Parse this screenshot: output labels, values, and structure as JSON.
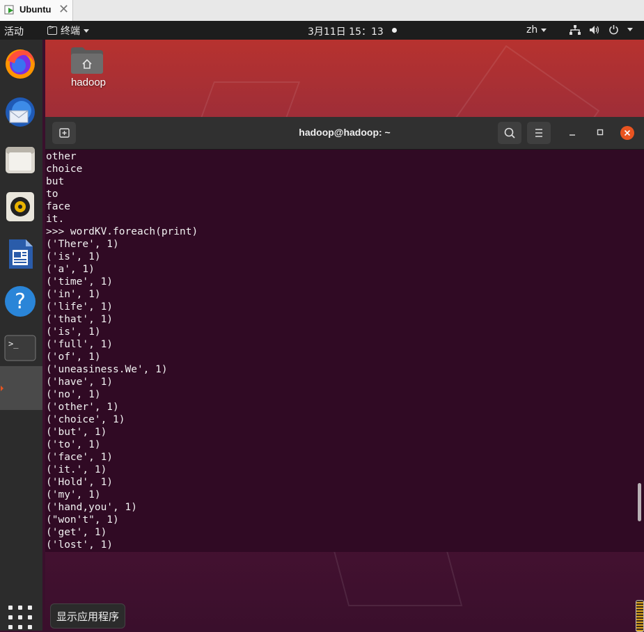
{
  "vm_tab": {
    "title": "Ubuntu",
    "close_glyph": "✕"
  },
  "topbar": {
    "activities": "活动",
    "app_menu": "终端",
    "clock": "3月11日  15：13",
    "input_method": "zh",
    "icons": [
      "network-icon",
      "volume-icon",
      "power-icon",
      "chevron-down-icon"
    ]
  },
  "desktop": {
    "home_label": "hadoop"
  },
  "dock": {
    "apps": [
      "firefox-icon",
      "thunderbird-icon",
      "files-icon",
      "rhythmbox-icon",
      "libreoffice-writer-icon",
      "help-icon",
      "terminal-icon"
    ],
    "tooltip": "显示应用程序"
  },
  "terminal": {
    "title": "hadoop@hadoop: ~",
    "lines": [
      "other",
      "choice",
      "but",
      "to",
      "face",
      "it.",
      ">>> wordKV.foreach(print)",
      "('There', 1)",
      "('is', 1)",
      "('a', 1)",
      "('time', 1)",
      "('in', 1)",
      "('life', 1)",
      "('that', 1)",
      "('is', 1)",
      "('full', 1)",
      "('of', 1)",
      "('uneasiness.We', 1)",
      "('have', 1)",
      "('no', 1)",
      "('other', 1)",
      "('choice', 1)",
      "('but', 1)",
      "('to', 1)",
      "('face', 1)",
      "('it.', 1)",
      "('Hold', 1)",
      "('my', 1)",
      "('hand,you', 1)",
      "(\"won't\", 1)",
      "('get', 1)",
      "('lost', 1)"
    ]
  },
  "colors": {
    "accent": "#e95420",
    "terminal_bg": "#300a24",
    "topbar_bg": "#1d1d1d"
  }
}
